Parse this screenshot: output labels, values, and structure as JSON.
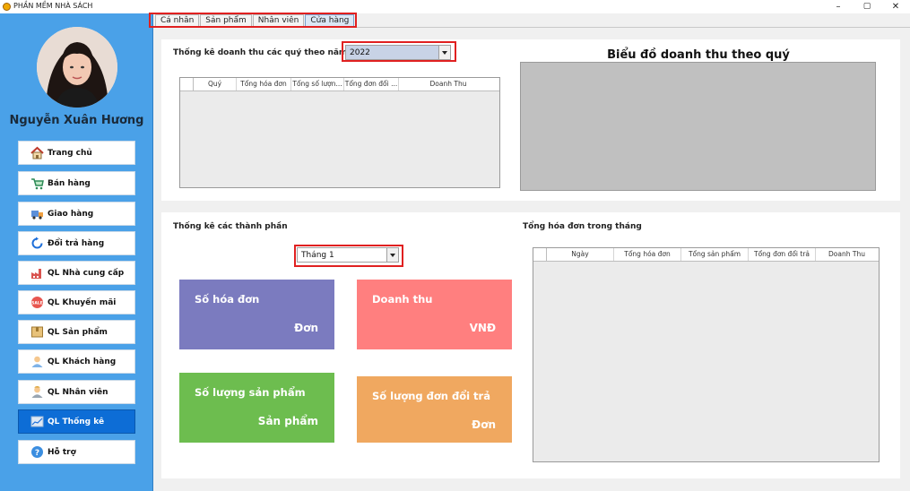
{
  "window": {
    "title": "PHẦN MỀM NHÀ SÁCH",
    "minimize": "–",
    "maximize": "▢",
    "close": "✕"
  },
  "sidebar": {
    "user_name": "Nguyễn Xuân Hương",
    "items": [
      {
        "label": "Trang chủ",
        "icon": "home-icon"
      },
      {
        "label": "Bán hàng",
        "icon": "cart-icon"
      },
      {
        "label": "Giao hàng",
        "icon": "truck-icon"
      },
      {
        "label": "Đổi trả hàng",
        "icon": "refresh-icon"
      },
      {
        "label": "QL Nhà cung cấp",
        "icon": "factory-icon"
      },
      {
        "label": "QL Khuyến mãi",
        "icon": "sale-icon"
      },
      {
        "label": "QL Sản phẩm",
        "icon": "box-icon"
      },
      {
        "label": "QL Khách hàng",
        "icon": "user-icon"
      },
      {
        "label": "QL Nhân viên",
        "icon": "employee-icon"
      },
      {
        "label": "QL Thống kê",
        "icon": "chart-icon"
      },
      {
        "label": "Hỗ trợ",
        "icon": "help-icon"
      }
    ],
    "active_index": 9
  },
  "tabs": [
    "Cá nhân",
    "Sản phẩm",
    "Nhân viên",
    "Cửa hàng"
  ],
  "active_tab": 3,
  "quarterly": {
    "title": "Thống kê doanh thu các quý theo năm",
    "year": "2022",
    "columns": [
      "Quý",
      "Tổng hóa đơn",
      "Tổng số lượn...",
      "Tổng đơn đổi ...",
      "Doanh Thu"
    ]
  },
  "chart": {
    "title": "Biểu đồ doanh thu theo quý"
  },
  "components": {
    "title": "Thống kê các thành phần",
    "month": "Tháng 1",
    "cards": [
      {
        "title": "Số hóa đơn",
        "unit": "Đơn",
        "color": "#7b7bbf"
      },
      {
        "title": "Doanh thu",
        "unit": "VNĐ",
        "color": "#ff7f7f"
      },
      {
        "title": "Số lượng sản phẩm",
        "unit": "Sản phẩm",
        "color": "#6dbd4f"
      },
      {
        "title": "Số lượng đơn đổi trả",
        "unit": "Đơn",
        "color": "#f0a860"
      }
    ]
  },
  "monthly": {
    "title": "Tổng hóa đơn trong tháng",
    "columns": [
      "Ngày",
      "Tổng hóa đơn",
      "Tổng sản phẩm",
      "Tổng đơn đổi trả",
      "Doanh Thu"
    ]
  }
}
